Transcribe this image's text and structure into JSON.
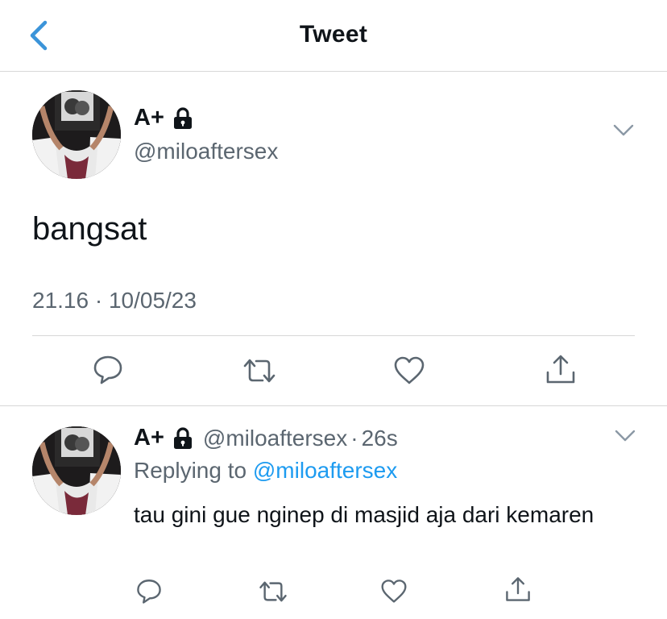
{
  "header": {
    "title": "Tweet"
  },
  "main_tweet": {
    "author_name": "A+",
    "handle": "@miloaftersex",
    "text": "bangsat",
    "meta": "21.16 · 10/05/23"
  },
  "reply": {
    "author_name": "A+",
    "handle": "@miloaftersex",
    "separator": "·",
    "time": "26s",
    "replying_prefix": "Replying to",
    "replying_to": "@miloaftersex",
    "text": "tau gini gue nginep di masjid aja dari kemaren"
  },
  "icons": {
    "back": "chevron-left-icon",
    "lock": "lock-icon",
    "more": "chevron-down-icon",
    "reply": "speech-bubble-icon",
    "retweet": "retweet-icon",
    "like": "heart-icon",
    "share": "share-icon"
  },
  "colors": {
    "accent": "#1d9bf0",
    "back_icon": "#3b94d9",
    "text_primary": "#0f1419",
    "text_secondary": "#5b6670",
    "divider": "#d7d7d7"
  }
}
